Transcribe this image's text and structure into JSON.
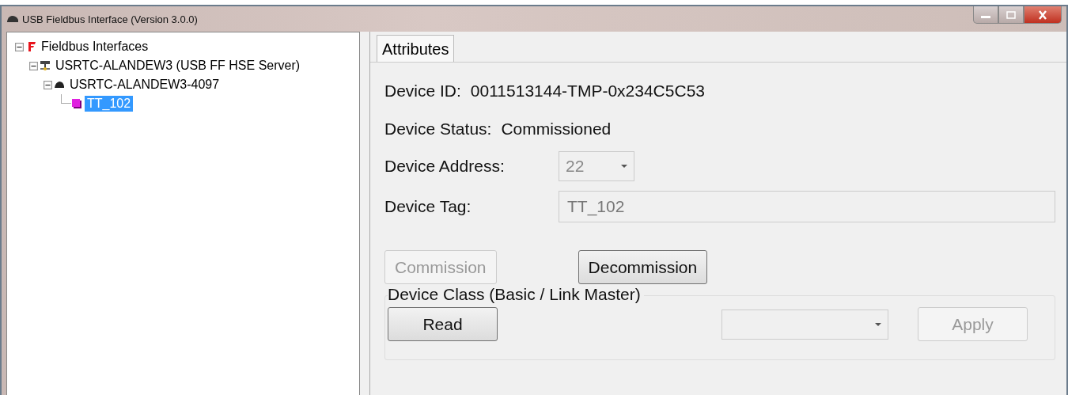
{
  "window": {
    "title": "USB Fieldbus Interface (Version 3.0.0)"
  },
  "tree": [
    {
      "label": "Fieldbus Interfaces",
      "kind": "root",
      "expanded": true,
      "selected": false,
      "children": [
        {
          "label": "USRTC-ALANDEW3 (USB FF HSE Server)",
          "kind": "server",
          "expanded": true,
          "selected": false,
          "children": [
            {
              "label": "USRTC-ALANDEW3-4097",
              "kind": "link",
              "expanded": true,
              "selected": false,
              "children": [
                {
                  "label": "TT_102",
                  "kind": "device",
                  "selected": true
                }
              ]
            }
          ]
        }
      ]
    }
  ],
  "tabs": [
    {
      "label": "Attributes",
      "selected": true
    }
  ],
  "device_id": {
    "label": "Device ID:",
    "value": "0011513144-TMP-0x234C5C53"
  },
  "device_status": {
    "label": "Device Status:",
    "value": "Commissioned"
  },
  "device_address": {
    "label": "Device Address:",
    "value": "22",
    "disabled": true
  },
  "device_tag": {
    "label": "Device Tag:",
    "value": "TT_102",
    "disabled": true
  },
  "commission_buttons": [
    {
      "label": "Commission",
      "disabled": true
    },
    {
      "label": "Decommission",
      "disabled": false
    }
  ],
  "device_class": {
    "title": "Device Class (Basic / Link Master)",
    "read_button": {
      "label": "Read",
      "disabled": false
    },
    "class_select": {
      "disabled": true
    },
    "apply_button": {
      "label": "Apply",
      "disabled": true
    }
  }
}
